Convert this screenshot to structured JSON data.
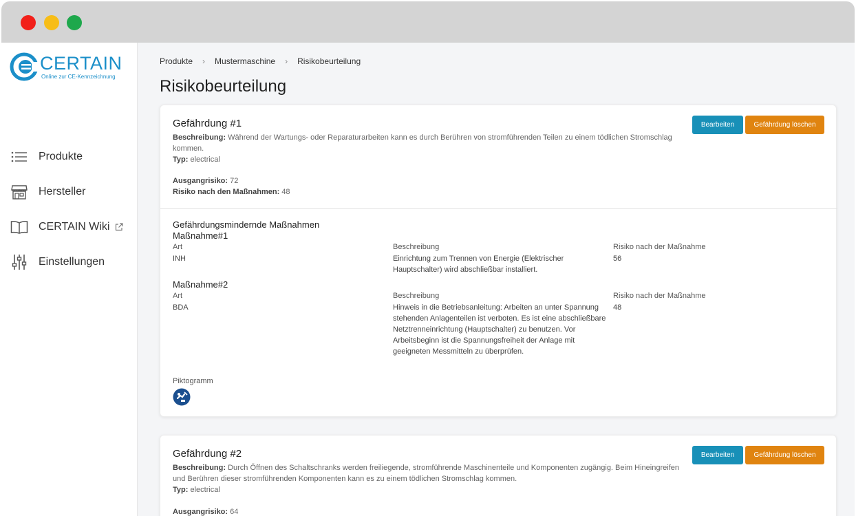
{
  "sidebar": {
    "logo_text": "CERTAIN",
    "logo_sub": "Online zur CE-Kennzeichnung",
    "items": [
      {
        "label": "Produkte",
        "icon": "list-icon"
      },
      {
        "label": "Hersteller",
        "icon": "store-icon"
      },
      {
        "label": "CERTAIN Wiki",
        "icon": "book-icon"
      },
      {
        "label": "Einstellungen",
        "icon": "sliders-icon"
      }
    ]
  },
  "breadcrumb": [
    "Produkte",
    "Mustermaschine",
    "Risikobeurteilung"
  ],
  "page_title": "Risikobeurteilung",
  "buttons": {
    "edit": "Bearbeiten",
    "delete": "Gefährdung löschen"
  },
  "labels": {
    "beschreibung": "Beschreibung:",
    "typ": "Typ:",
    "ausgangsrisiko": "Ausgangrisiko:",
    "risiko_nach": "Risiko nach den Maßnahmen:",
    "measures_title": "Gefährdungsmindernde Maßnahmen",
    "col_art": "Art",
    "col_beschreibung": "Beschreibung",
    "col_risiko": "Risiko nach der Maßnahme",
    "piktogramm": "Piktogramm"
  },
  "hazards": [
    {
      "title": "Gefährdung #1",
      "description": "Während der Wartungs- oder Reparaturarbeiten kann es durch Berühren von stromführenden Teilen zu einem tödlichen Stromschlag kommen.",
      "type": "electrical",
      "initial_risk": "72",
      "risk_after": "48",
      "measures": [
        {
          "title": "Maßnahme#1",
          "art": "INH",
          "description": "Einrichtung zum Trennen von Energie (Elektrischer Hauptschalter) wird abschließbar installiert.",
          "risk": "56"
        },
        {
          "title": "Maßnahme#2",
          "art": "BDA",
          "description": "Hinweis in die Betriebsanleitung: Arbeiten an unter Spannung stehenden Anlagenteilen ist verboten. Es ist eine abschließbare Netztrenneinrichtung (Hauptschalter) zu benutzen. Vor Arbeitsbeginn ist die Spannungsfreiheit der Anlage mit geeigneten Messmitteln zu überprüfen.",
          "risk": "48"
        }
      ]
    },
    {
      "title": "Gefährdung #2",
      "description": "Durch Öffnen des Schaltschranks werden freiliegende, stromführende Maschinenteile und Komponenten zugängig. Beim Hineingreifen und Berühren dieser stromführenden Komponenten kann es zu einem tödlichen Stromschlag kommen.",
      "type": "electrical",
      "initial_risk": "64"
    }
  ],
  "colors": {
    "accent": "#1b8fc9",
    "edit_button": "#1890b8",
    "delete_button": "#e08410"
  }
}
